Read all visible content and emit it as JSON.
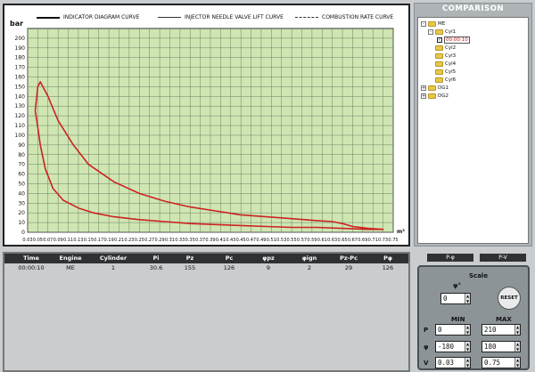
{
  "chart": {
    "legend": [
      "INDICATOR DIAGRAM CURVE",
      "INJECTOR NEEDLE VALVE LIFT CURVE",
      "COMBUSTION RATE CURVE"
    ],
    "y_unit": "bar",
    "x_unit": "m³"
  },
  "chart_data": {
    "type": "line",
    "ylim": [
      0,
      210
    ],
    "xlim": [
      0.03,
      0.75
    ],
    "y_ticks": [
      "0",
      "10",
      "20",
      "30",
      "40",
      "50",
      "60",
      "70",
      "80",
      "90",
      "100",
      "110",
      "120",
      "130",
      "140",
      "150",
      "160",
      "170",
      "180",
      "190",
      "200"
    ],
    "y_tick_values": [
      0,
      10,
      20,
      30,
      40,
      50,
      60,
      70,
      80,
      90,
      100,
      110,
      120,
      130,
      140,
      150,
      160,
      170,
      180,
      190,
      200
    ],
    "x_ticks": [
      "0.03",
      "0.05",
      "0.07",
      "0.09",
      "0.11",
      "0.13",
      "0.15",
      "0.17",
      "0.19",
      "0.21",
      "0.23",
      "0.25",
      "0.27",
      "0.29",
      "0.31",
      "0.33",
      "0.35",
      "0.37",
      "0.39",
      "0.41",
      "0.43",
      "0.45",
      "0.47",
      "0.49",
      "0.51",
      "0.53",
      "0.55",
      "0.57",
      "0.59",
      "0.61",
      "0.63",
      "0.65",
      "0.67",
      "0.69",
      "0.71",
      "0.73",
      "0.75"
    ],
    "x_tick_values": [
      0.03,
      0.05,
      0.07,
      0.09,
      0.11,
      0.13,
      0.15,
      0.17,
      0.19,
      0.21,
      0.23,
      0.25,
      0.27,
      0.29,
      0.31,
      0.33,
      0.35,
      0.37,
      0.39,
      0.41,
      0.43,
      0.45,
      0.47,
      0.49,
      0.51,
      0.53,
      0.55,
      0.57,
      0.59,
      0.61,
      0.63,
      0.65,
      0.67,
      0.69,
      0.71,
      0.73,
      0.75
    ],
    "series": [
      {
        "color": "#cc2222",
        "x": [
          0.045,
          0.05,
          0.055,
          0.07,
          0.09,
          0.12,
          0.15,
          0.2,
          0.25,
          0.3,
          0.35,
          0.4,
          0.45,
          0.5,
          0.55,
          0.6,
          0.63,
          0.65,
          0.67,
          0.7,
          0.73,
          0.7,
          0.65,
          0.6,
          0.55,
          0.5,
          0.45,
          0.4,
          0.35,
          0.3,
          0.25,
          0.2,
          0.16,
          0.13,
          0.1,
          0.08,
          0.065,
          0.055,
          0.048,
          0.045
        ],
        "y": [
          125,
          150,
          155,
          140,
          115,
          90,
          70,
          52,
          40,
          32,
          26,
          22,
          18,
          16,
          14,
          12,
          11,
          9,
          6,
          4,
          3,
          3,
          4,
          5,
          5,
          6,
          7,
          8,
          9,
          11,
          13,
          16,
          20,
          25,
          33,
          45,
          65,
          90,
          115,
          125
        ]
      }
    ]
  },
  "comparison": {
    "title": "COMPARISON",
    "tree": {
      "me": "ME",
      "cyl1": "Cyl1",
      "time": "00:00:10",
      "cyl2": "Cyl2",
      "cyl3": "Cyl3",
      "cyl4": "Cyl4",
      "cyl5": "Cyl5",
      "cyl6": "Cyl6",
      "dg1": "DG1",
      "dg2": "DG2"
    },
    "minus": "-",
    "plus": "+"
  },
  "table": {
    "headers": [
      "Time",
      "Engine",
      "Cylinder",
      "Pi",
      "Pz",
      "Pc",
      "φpz",
      "φign",
      "Pz-Pc",
      "Pφ"
    ],
    "row": [
      "00:00:10",
      "ME",
      "1",
      "30.6",
      "155",
      "126",
      "9",
      "2",
      "29",
      "126"
    ]
  },
  "controls": {
    "tabs": [
      "P-φ",
      "P-V"
    ],
    "scale_label": "Scale",
    "phi_label": "φ°",
    "phi_value": "0",
    "reset_label": "RESET",
    "min_label": "MIN",
    "max_label": "MAX",
    "row_labels": [
      "P",
      "φ",
      "V"
    ],
    "p_min": "0",
    "p_max": "210",
    "phi_min": "-180",
    "phi_max": "180",
    "v_min": "0.03",
    "v_max": "0.75",
    "up": "▲",
    "down": "▼"
  }
}
